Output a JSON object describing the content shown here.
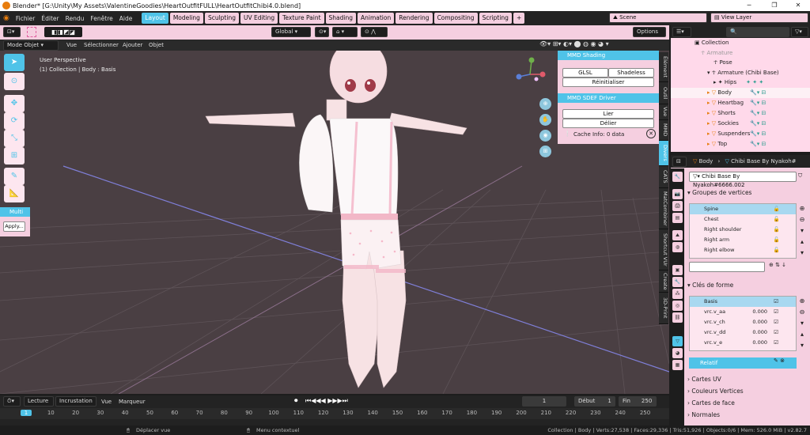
{
  "window": {
    "title": "Blender* [G:\\Unity\\My Assets\\ValentineGoodies\\HeartOutfitFULL\\HeartOutfitChibi4.0.blend]"
  },
  "menu": [
    "Fichier",
    "Éditer",
    "Rendu",
    "Fenêtre",
    "Aide"
  ],
  "workspaces": [
    "Layout",
    "Modeling",
    "Sculpting",
    "UV Editing",
    "Texture Paint",
    "Shading",
    "Animation",
    "Rendering",
    "Compositing",
    "Scripting"
  ],
  "scene": {
    "name": "Scene",
    "view_layer": "View Layer"
  },
  "viewport": {
    "mode": "Mode Objet",
    "menus": [
      "Vue",
      "Sélectionner",
      "Ajouter",
      "Objet"
    ],
    "transform": "Global",
    "options": "Options",
    "perspective": "User Perspective",
    "context": "(1) Collection | Body : Basis",
    "last_op": "Multi",
    "apply": "Apply..."
  },
  "npanel": {
    "mmd_shading": "MMD Shading",
    "glsl": "GLSL",
    "shadeless": "Shadeless",
    "reset": "Réinitialiser",
    "sdef": "MMD SDEF Driver",
    "bind": "Lier",
    "unbind": "Délier",
    "cache": "Cache Info: 0 data",
    "tabs": [
      "Élément",
      "Outil",
      "Vue",
      "MMD",
      "Divers",
      "CATS",
      "MatCombiner",
      "Shortcut VUr",
      "Create",
      "3D-Print"
    ]
  },
  "outliner": {
    "collection": "Collection",
    "armature_obj": "Armature",
    "pose": "Pose",
    "armature": "Armature (Chibi Base)",
    "hips": "Hips",
    "objects": [
      "Body",
      "Heartbag",
      "Shorts",
      "Sockies",
      "Suspenders",
      "Top"
    ]
  },
  "properties": {
    "breadcrumb_obj": "Body",
    "breadcrumb_mesh": "Chibi Base By Nyakoh#",
    "mesh_name": "Chibi Base By Nyakoh#6666.002",
    "vertex_groups_title": "Groupes de vertices",
    "vertex_groups": [
      "Spine",
      "Chest",
      "Right shoulder",
      "Right arm",
      "Right elbow"
    ],
    "shape_keys_title": "Clés de forme",
    "shape_keys": [
      {
        "name": "Basis",
        "value": ""
      },
      {
        "name": "vrc.v_aa",
        "value": "0.000"
      },
      {
        "name": "vrc.v_ch",
        "value": "0.000"
      },
      {
        "name": "vrc.v_dd",
        "value": "0.000"
      },
      {
        "name": "vrc.v_e",
        "value": "0.000"
      }
    ],
    "relative": "Relatif",
    "sections": [
      "Cartes UV",
      "Couleurs Vertices",
      "Cartes de face",
      "Normales"
    ]
  },
  "timeline": {
    "playback": "Lecture",
    "keying": "Incrustation",
    "view": "Vue",
    "marker": "Marqueur",
    "current": "1",
    "start_label": "Début",
    "start": "1",
    "end_label": "Fin",
    "end": "250",
    "ticks": [
      "1",
      "10",
      "20",
      "30",
      "40",
      "50",
      "60",
      "70",
      "80",
      "90",
      "100",
      "110",
      "120",
      "130",
      "140",
      "150",
      "160",
      "170",
      "180",
      "190",
      "200",
      "210",
      "220",
      "230",
      "240",
      "250"
    ]
  },
  "status": {
    "move": "Déplacer vue",
    "context_menu": "Menu contextuel",
    "stats": "Collection | Body | Verts:27,538 | Faces:29,336 | Tris:51,926 | Objects:0/6 | Mem: 526.0 MiB | v2.82.7"
  },
  "colors": {
    "accent": "#4fc3e8",
    "pink": "#f5cfe0",
    "viewport_bg": "#4a3f43"
  }
}
